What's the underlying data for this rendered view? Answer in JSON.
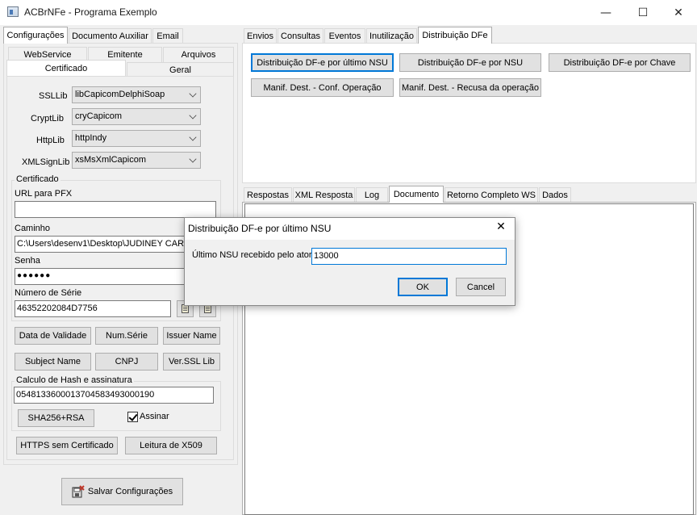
{
  "window": {
    "title": "ACBrNFe - Programa Exemplo",
    "minimize": "—",
    "maximize": "☐",
    "close": "✕"
  },
  "left_tabs": [
    "Configurações",
    "Documento Auxiliar",
    "Email"
  ],
  "sub_tabs_row1": [
    "WebService",
    "Emitente",
    "Arquivos"
  ],
  "sub_tabs_row2": [
    "Certificado",
    "Geral"
  ],
  "libs": [
    {
      "label": "SSLLib",
      "value": "libCapicomDelphiSoap"
    },
    {
      "label": "CryptLib",
      "value": "cryCapicom"
    },
    {
      "label": "HttpLib",
      "value": "httpIndy"
    },
    {
      "label": "XMLSignLib",
      "value": "xsMsXmlCapicom"
    }
  ],
  "certificado": {
    "group_title": "Certificado",
    "url_label": "URL para PFX",
    "url_value": "",
    "caminho_label": "Caminho",
    "caminho_value": "C:\\Users\\desenv1\\Desktop\\JUDINEY CARV",
    "senha_label": "Senha",
    "senha_value": "●●●●●●",
    "serie_label": "Número de Série",
    "serie_value": "46352202084D7756"
  },
  "cert_buttons": [
    "Data de Validade",
    "Num.Série",
    "Issuer Name",
    "Subject Name",
    "CNPJ",
    "Ver.SSL Lib"
  ],
  "hash": {
    "group_title": "Calculo de Hash e assinatura",
    "value": "05481336000137045834930001​90",
    "sha_button": "SHA256+RSA",
    "assinar_label": "Assinar",
    "assinar_checked": true
  },
  "bottom_buttons": [
    "HTTPS sem Certificado",
    "Leitura de X509"
  ],
  "save_button": "Salvar Configurações",
  "right_tabs": [
    "Envios",
    "Consultas",
    "Eventos",
    "Inutilização",
    "Distribuição DFe"
  ],
  "dfe_buttons": [
    "Distribuição DF-e por último NSU",
    "Distribuição DF-e por NSU",
    "Distribuição DF-e por Chave",
    "Manif. Dest. - Conf. Operação",
    "Manif. Dest. - Recusa da operação"
  ],
  "response_tabs": [
    "Respostas",
    "XML Resposta",
    "Log",
    "Documento",
    "Retorno Completo WS",
    "Dados"
  ],
  "dialog": {
    "title": "Distribuição DF-e por último NSU",
    "close": "✕",
    "field_label": "Último NSU recebido pelo ator",
    "field_value": "13000",
    "ok": "OK",
    "cancel": "Cancel"
  }
}
